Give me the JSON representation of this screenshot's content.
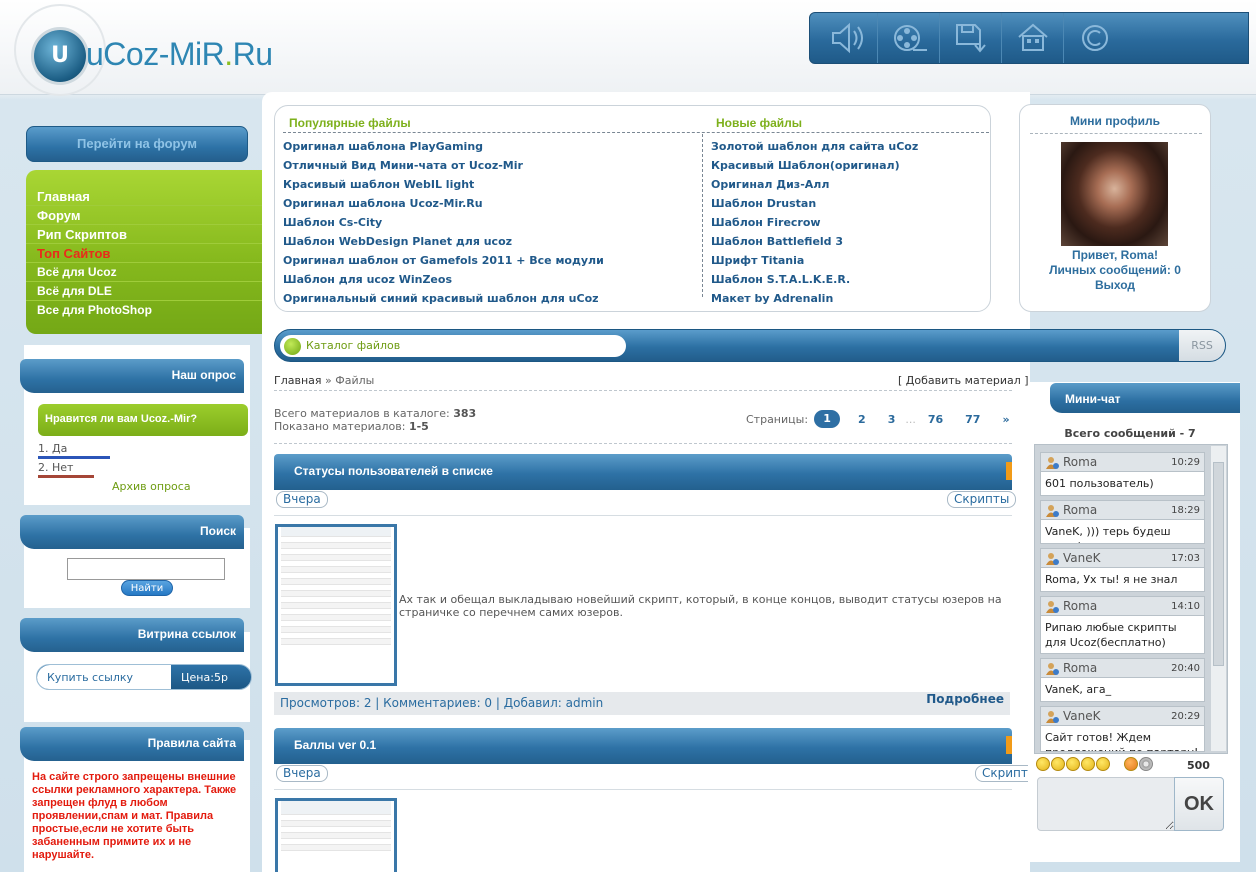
{
  "logo": {
    "prefix": "u",
    "name": "Coz-MiR",
    "dot": ".",
    "tld": "Ru",
    "badge": "U"
  },
  "top_menu": [
    "speaker-icon",
    "film-reel-icon",
    "save-download-icon",
    "home-icon",
    "copyright-icon"
  ],
  "sidebar": {
    "forum_button": "Перейти на форум",
    "nav": [
      "Главная",
      "Форум",
      "Рип Скриптов",
      "Топ Сайтов",
      "Всё для Ucoz",
      "Всё для DLE",
      "Все для PhotoShop"
    ],
    "poll": {
      "title": "Наш опрос",
      "question": "Нравится ли вам Ucoz.-Mir?",
      "answers": [
        "1. Да",
        "2. Нет"
      ],
      "archive": "Архив опроса"
    },
    "search": {
      "title": "Поиск",
      "button": "Найти",
      "value": ""
    },
    "links": {
      "title": "Витрина ссылок",
      "buy": "Купить ссылку",
      "price": "Цена:5р"
    },
    "rules": {
      "title": "Правила сайта",
      "text": "На сайте строго запрещены внешние ссылки рекламного характера. Также запрещен флуд в любом проявлении,спам и мат. Правила простые,если не хотите быть забаненным примите их и не нарушайте."
    }
  },
  "files": {
    "popular_title": "Популярные файлы",
    "new_title": "Новые файлы",
    "popular": [
      "Оригинал шаблона PlayGaming",
      "Отличный Вид Мини-чата от Ucoz-Mir",
      "Красивый шаблон WebIL light",
      "Оригинал шаблона Ucoz-Mir.Ru",
      "Шаблон Cs-City",
      "Шаблон WebDesign Planet для ucoz",
      "Оригинал шаблон от Gamefols 2011 + Все модули",
      "Шаблон для ucoz WinZeos",
      "Оригинальный синий красивый шаблон для uCoz"
    ],
    "new": [
      "Золотой шаблон для сайта uCoz",
      "Красивый Шаблон(оригинал)",
      "Оригинал Диз-Алл",
      "Шаблон Drustan",
      "Шаблон Firecrow",
      "Шаблон Battlefield 3",
      "Шрифт Titania",
      "Шаблон S.T.A.L.K.E.R.",
      "Макет by Adrenalin"
    ]
  },
  "catalog": {
    "title": "Каталог файлов",
    "rss": "RSS"
  },
  "breadcrumb": {
    "home": "Главная",
    "sep": " » ",
    "current": "Файлы",
    "add": "[ Добавить материал ]"
  },
  "stats": {
    "total_label": "Всего материалов в каталоге: ",
    "total": "383",
    "shown_label": "Показано материалов: ",
    "shown": "1-5"
  },
  "pager": {
    "label": "Страницы:",
    "pages": [
      "1",
      "2",
      "3",
      "...",
      "76",
      "77",
      "»"
    ]
  },
  "entries": [
    {
      "title": "Статусы пользователей в списке",
      "date": "Вчера",
      "category": "Скрипты",
      "text": "Ах так и обещал выкладываю новейший скрипт, который, в конце концов, выводит статусы юзеров на страничке со перечнем самих юзеров.",
      "footer": "Просмотров: 2 | Комментариев: 0 | Добавил: admin",
      "more": "Подробнее"
    },
    {
      "title": "Баллы ver 0.1",
      "date": "Вчера",
      "category": "Скрипты"
    }
  ],
  "profile": {
    "title": "Мини профиль",
    "greeting": "Привет, Roma!",
    "messages": "Личных сообщений: 0",
    "logout": "Выход"
  },
  "chat": {
    "title": "Мини-чат",
    "total": "Всего сообщений - 7",
    "messages": [
      {
        "user": "Roma",
        "time": "10:29",
        "text": "601 пользователь)"
      },
      {
        "user": "Roma",
        "time": "18:29",
        "text": "VaneK, ))) терь будеш знать)"
      },
      {
        "user": "VaneK",
        "time": "17:03",
        "text": "Roma, Ух ты! я не знал"
      },
      {
        "user": "Roma",
        "time": "14:10",
        "text": "Рипаю любые скрипты для Ucoz(бесплатно) писать в ЛС"
      },
      {
        "user": "Roma",
        "time": "20:40",
        "text": "VaneK, ага_"
      },
      {
        "user": "VaneK",
        "time": "20:29",
        "text": "Сайт готов! Ждем предложений по партару! и"
      }
    ],
    "char_limit": "500",
    "send": "OK"
  }
}
